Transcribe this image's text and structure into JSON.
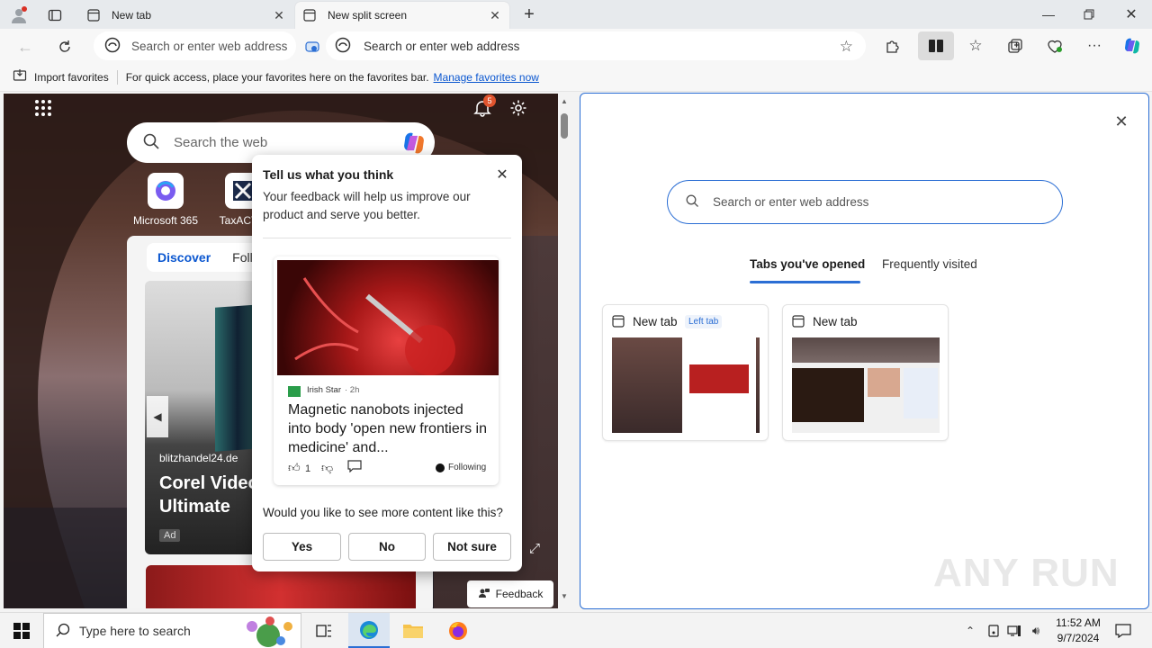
{
  "browser": {
    "tabs": [
      {
        "title": "New tab"
      },
      {
        "title": "New split screen"
      }
    ],
    "address_placeholder_left": "Search or enter web address",
    "address_placeholder_right": "Search or enter web address",
    "favorites": {
      "import_label": "Import favorites",
      "hint": "For quick access, place your favorites here on the favorites bar.",
      "manage_link": "Manage favorites now"
    }
  },
  "left_pane": {
    "notification_count": "5",
    "search_placeholder": "Search the web",
    "quicklinks": [
      {
        "label": "Microsoft 365"
      },
      {
        "label": "TaxACT"
      }
    ],
    "feed_tabs": [
      "Discover",
      "Follo"
    ],
    "ad": {
      "source": "blitzhandel24.de",
      "title_line1": "Corel Video",
      "title_line2": "Ultimate",
      "ad_badge": "Ad"
    },
    "feedback_button": "Feedback"
  },
  "popup": {
    "title": "Tell us what you think",
    "subtitle": "Your feedback will help us improve our product and serve you better.",
    "article": {
      "source": "Irish Star",
      "age": "· 2h",
      "headline": "Magnetic nanobots injected into body 'open new frontiers in medicine' and...",
      "likes": "1",
      "following": "Following"
    },
    "question": "Would you like to see more content like this?",
    "buttons": [
      "Yes",
      "No",
      "Not sure"
    ]
  },
  "right_pane": {
    "search_placeholder": "Search or enter web address",
    "tabs": [
      "Tabs you've opened",
      "Frequently visited"
    ],
    "cards": [
      {
        "title": "New tab",
        "badge": "Left tab"
      },
      {
        "title": "New tab",
        "badge": ""
      }
    ]
  },
  "taskbar": {
    "search_placeholder": "Type here to search",
    "time": "11:52 AM",
    "date": "9/7/2024"
  },
  "watermark": "ANY RUN"
}
